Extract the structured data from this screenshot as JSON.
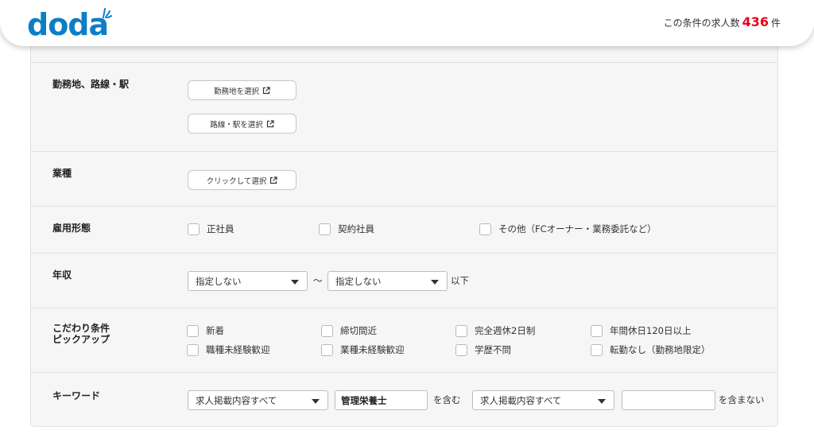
{
  "header": {
    "logo": "doda",
    "count_prefix": "この条件の求人数",
    "count_value": "436",
    "count_suffix": "件",
    "brand_color": "#0d7ec6",
    "count_color": "#e8001c"
  },
  "location": {
    "label": "勤務地、路線・駅",
    "select_area_button": "勤務地を選択",
    "select_line_button": "路線・駅を選択"
  },
  "industry": {
    "label": "業種",
    "select_button": "クリックして選択"
  },
  "employment": {
    "label": "雇用形態",
    "options": [
      "正社員",
      "契約社員",
      "その他（FCオーナー・業務委託など）"
    ]
  },
  "salary": {
    "label": "年収",
    "min_value": "指定しない",
    "tilde": "〜",
    "max_value": "指定しない",
    "suffix": "以下"
  },
  "conditions": {
    "label_line1": "こだわり条件",
    "label_line2": "ピックアップ",
    "options": [
      "新着",
      "締切間近",
      "完全週休2日制",
      "年間休日120日以上",
      "職種未経験歓迎",
      "業種未経験歓迎",
      "学歴不問",
      "転勤なし（勤務地限定）"
    ]
  },
  "keyword": {
    "label": "キーワード",
    "include_scope": "求人掲載内容すべて",
    "include_value": "管理栄養士",
    "include_suffix": "を含む",
    "exclude_scope": "求人掲載内容すべて",
    "exclude_value": "",
    "exclude_suffix": "を含まない"
  }
}
